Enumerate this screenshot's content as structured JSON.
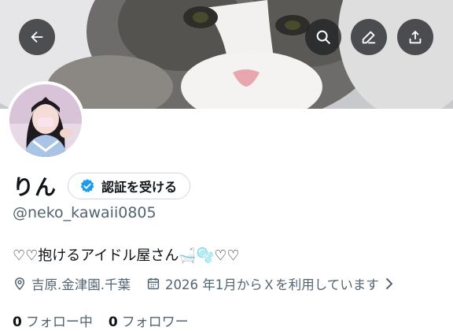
{
  "header": {
    "back_icon": "arrow-left-icon",
    "search_icon": "search-icon",
    "edit_icon": "pencil-icon",
    "share_icon": "share-upload-icon",
    "button_bg": "#202326"
  },
  "profile": {
    "name": "りん",
    "verify_label": "認証を受ける",
    "verify_icon": "verified-badge-icon",
    "verify_color": "#1d9bf0",
    "handle": "@neko_kawaii0805",
    "bio": "♡♡抱けるアイドル屋さん🛁🫧♡♡",
    "location_icon": "location-pin-icon",
    "location": "吉原.金津園.千葉",
    "joined_icon": "calendar-icon",
    "joined": "2026 年1月からＸを利用しています",
    "chevron_icon": "chevron-right-icon"
  },
  "stats": {
    "following_count": "0",
    "following_label": "フォロー中",
    "followers_count": "0",
    "followers_label": "フォロワー"
  }
}
